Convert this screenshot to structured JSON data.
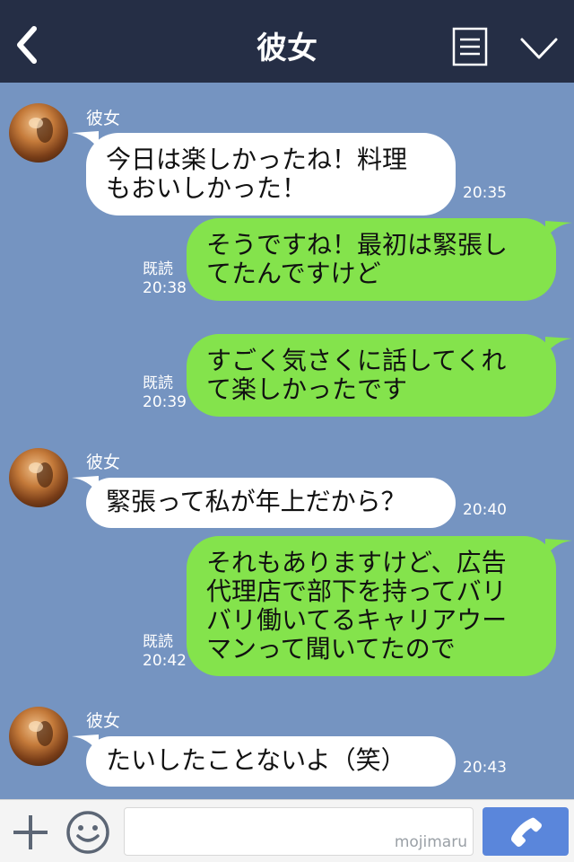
{
  "header": {
    "title": "彼女",
    "back_icon": "chevron-left-icon",
    "menu_icon": "menu-icon",
    "expand_icon": "chevron-down-icon",
    "background": "#252e45"
  },
  "chat": {
    "background": "#7594c1",
    "bubble_left_color": "#ffffff",
    "bubble_right_color": "#84e34c",
    "messages": [
      {
        "side": "left",
        "sender": "彼女",
        "lines": [
          "今日は楽しかったね！料理",
          "もおいしかった！"
        ],
        "time": "20:35"
      },
      {
        "side": "right",
        "read": "既読",
        "lines": [
          "そうですね！最初は緊張し",
          "てたんですけど"
        ],
        "time": "20:38"
      },
      {
        "side": "right",
        "read": "既読",
        "lines": [
          "すごく気さくに話してくれ",
          "て楽しかったです"
        ],
        "time": "20:39"
      },
      {
        "side": "left",
        "sender": "彼女",
        "lines": [
          "緊張って私が年上だから？"
        ],
        "time": "20:40"
      },
      {
        "side": "right",
        "read": "既読",
        "lines": [
          "それもありますけど、広告",
          "代理店で部下を持ってバリ",
          "バリ働いてるキャリアウー",
          "マンって聞いてたので"
        ],
        "time": "20:42"
      },
      {
        "side": "left",
        "sender": "彼女",
        "lines": [
          "たいしたことないよ（笑）"
        ],
        "time": "20:43"
      }
    ]
  },
  "bottom_bar": {
    "add_icon": "plus-icon",
    "emoji_icon": "smiley-icon",
    "input_value": "",
    "watermark": "mojimaru",
    "call_icon": "phone-icon",
    "call_button_color": "#5a86db"
  }
}
